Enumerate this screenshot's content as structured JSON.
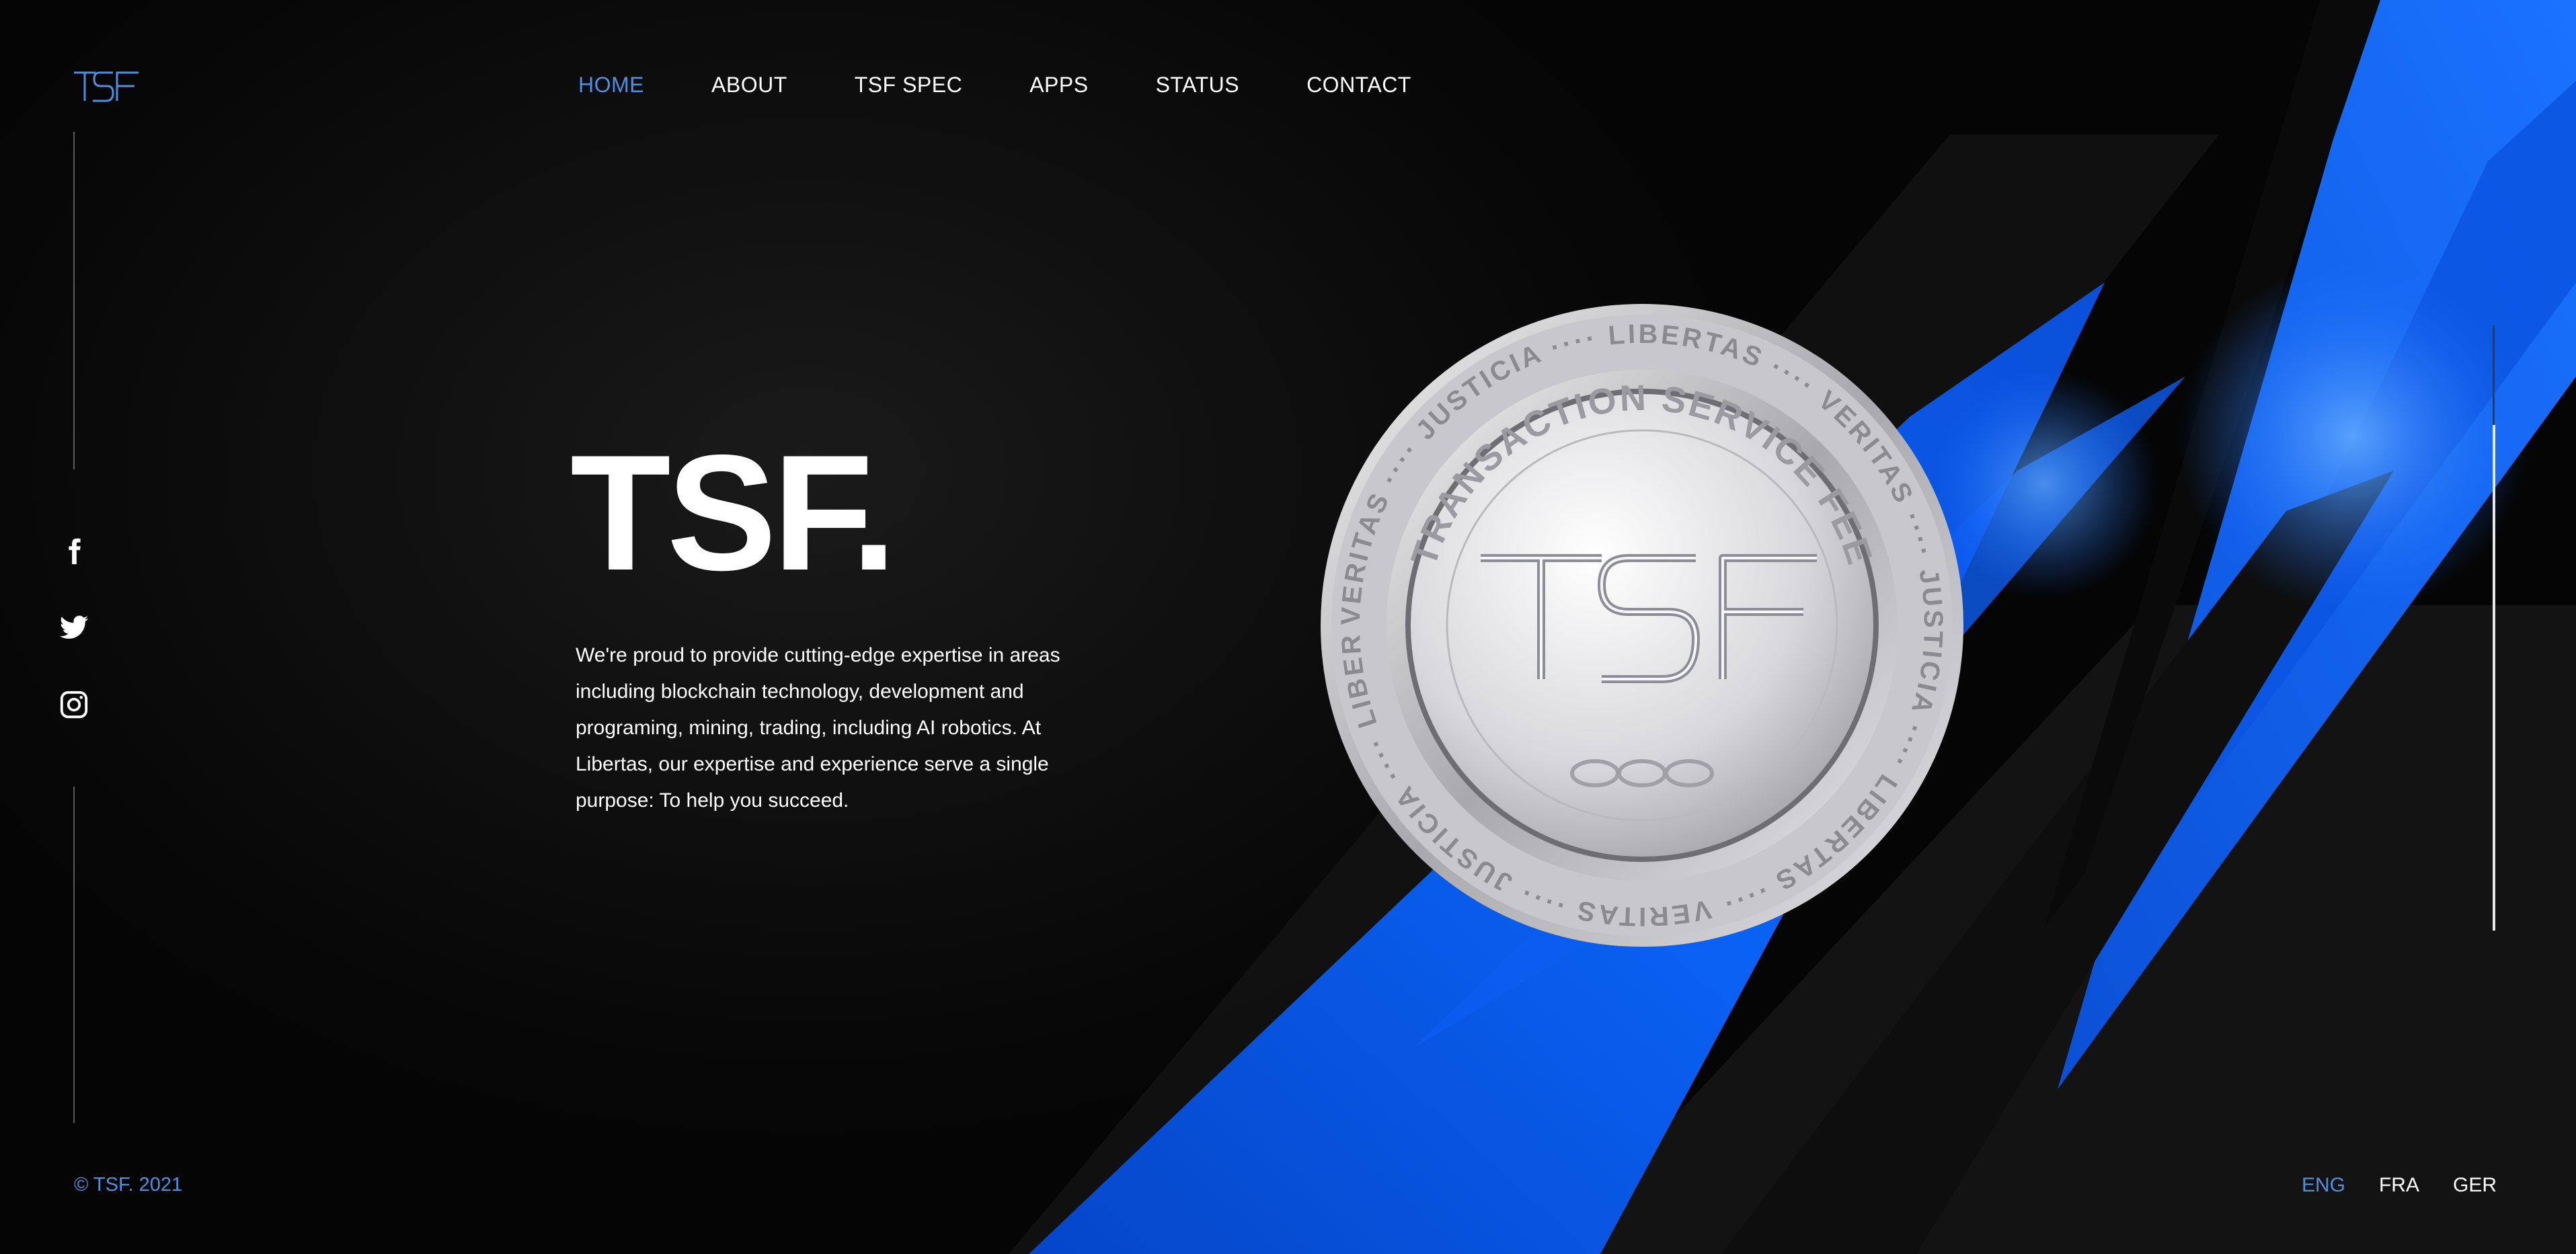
{
  "brand": {
    "logo_text": "TSF"
  },
  "nav": {
    "items": [
      {
        "label": "HOME",
        "active": true
      },
      {
        "label": "ABOUT",
        "active": false
      },
      {
        "label": "TSF SPEC",
        "active": false
      },
      {
        "label": "APPS",
        "active": false
      },
      {
        "label": "STATUS",
        "active": false
      },
      {
        "label": "CONTACT",
        "active": false
      }
    ]
  },
  "social": {
    "icons": [
      "facebook-icon",
      "twitter-icon",
      "instagram-icon"
    ]
  },
  "hero": {
    "title": "TSF.",
    "description": "We're proud to provide cutting-edge expertise in areas including blockchain technology, development and programing, mining, trading, including AI robotics. At Libertas, our expertise and experience serve a single purpose: To help you succeed."
  },
  "coin": {
    "center_text": "TSF",
    "arc_text": "TRANSACTION SERVICE FEE",
    "rim_words": [
      "VERITAS",
      "JUSTICIA",
      "LIBERTAS",
      "VERITAS",
      "JUSTICIA",
      "LIBERTAS",
      "VERITAS",
      "JUSTICIA",
      "LIBERTAS"
    ]
  },
  "footer": {
    "copyright": "© TSF. 2021",
    "languages": [
      {
        "label": "ENG",
        "active": true
      },
      {
        "label": "FRA",
        "active": false
      },
      {
        "label": "GER",
        "active": false
      }
    ]
  },
  "colors": {
    "accent": "#4d8fe0",
    "background": "#0b0b0b",
    "blue_shape": "#0a5ef0"
  }
}
